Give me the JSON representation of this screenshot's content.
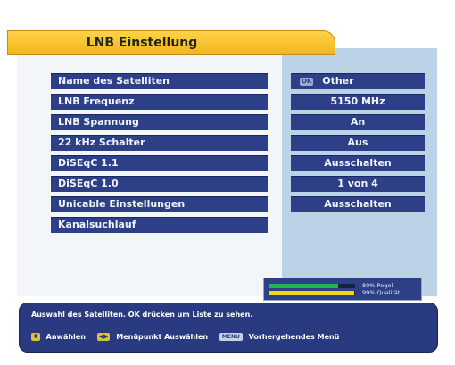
{
  "title": "LNB Einstellung",
  "settings": [
    {
      "label": "Name des Satelliten",
      "value": "Other",
      "badge": "OK"
    },
    {
      "label": "LNB Frequenz",
      "value": "5150 MHz"
    },
    {
      "label": "LNB Spannung",
      "value": "An"
    },
    {
      "label": "22 kHz Schalter",
      "value": "Aus"
    },
    {
      "label": "DiSEqC 1.1",
      "value": "Ausschalten"
    },
    {
      "label": "DiSEqC 1.0",
      "value": "1 von 4"
    },
    {
      "label": "Unicable Einstellungen",
      "value": "Ausschalten"
    },
    {
      "label": "Kanalsuchlauf"
    }
  ],
  "signal": {
    "level_percent": 80,
    "quality_percent": 99,
    "level_text": "80% Pegel",
    "quality_text": "99% Qualität",
    "level_color": "#1eb84a",
    "quality_color": "#f2d51b"
  },
  "help": {
    "line": "Auswahl des Satelliten. OK drücken um Liste zu sehen.",
    "hints": [
      {
        "icon": "up-down-arrows-icon",
        "glyph": "⬍",
        "text": "Anwählen"
      },
      {
        "icon": "left-right-arrows-icon",
        "glyph": "◀▶",
        "text": "Menüpunkt Auswählen"
      },
      {
        "icon": "menu-key-icon",
        "glyph": "MENU",
        "text": "Vorhergehendes Menü"
      }
    ]
  },
  "colors": {
    "row_bg": "#2d3f86",
    "title_tab": "#f4b51a",
    "values_panel": "#bcd3e7",
    "help_panel": "#2a3a80"
  }
}
